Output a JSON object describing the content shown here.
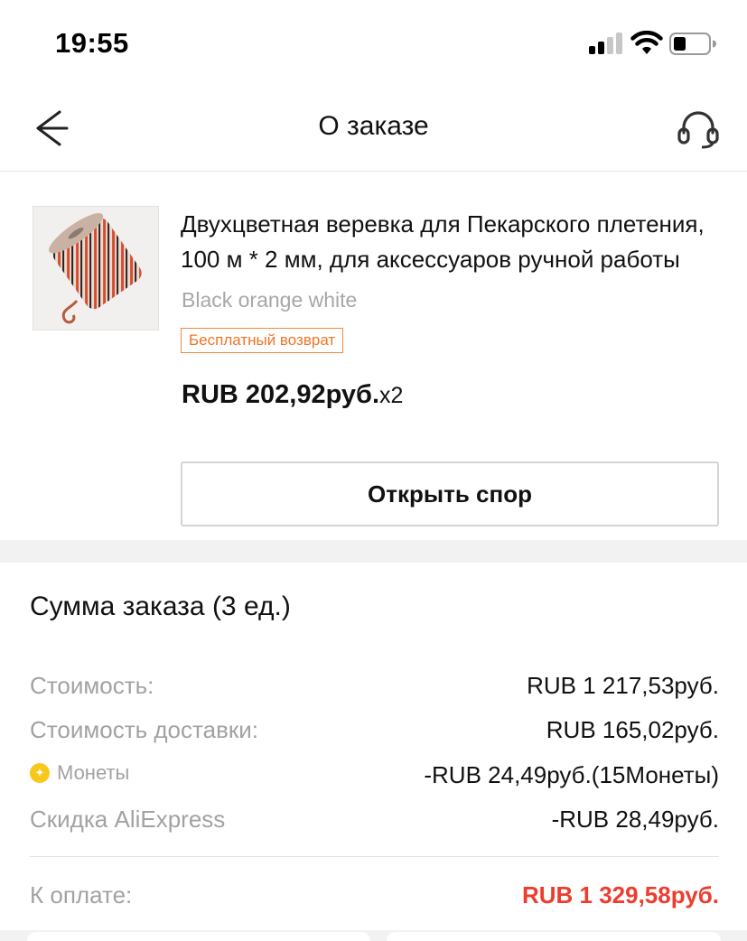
{
  "status_bar": {
    "time": "19:55"
  },
  "header": {
    "title": "О заказе",
    "back_icon": "arrow-left-icon",
    "support_icon": "headset-icon"
  },
  "product": {
    "title": "Двухцветная веревка для Пекарского плетения, 100 м * 2 мм, для аксессуаров ручной работы",
    "variant": "Black orange white",
    "badge": "Бесплатный возврат",
    "price": "RUB 202,92руб.",
    "quantity": "x2",
    "dispute_button": "Открыть спор"
  },
  "summary": {
    "title": "Сумма заказа (3 ед.)",
    "rows": [
      {
        "label": "Стоимость:",
        "value": "RUB 1 217,53руб."
      },
      {
        "label": "Стоимость доставки:",
        "value": "RUB 165,02руб."
      },
      {
        "label": "Монеты",
        "value": "-RUB 24,49руб.(15Монеты)"
      },
      {
        "label": "Скидка AliExpress",
        "value": "-RUB 28,49руб."
      }
    ],
    "total_label": "К оплате:",
    "total_value": "RUB 1 329,58руб."
  },
  "colors": {
    "accent_red": "#ee3d2f",
    "badge_orange": "#f07427",
    "coin_yellow": "#f7c81b"
  }
}
